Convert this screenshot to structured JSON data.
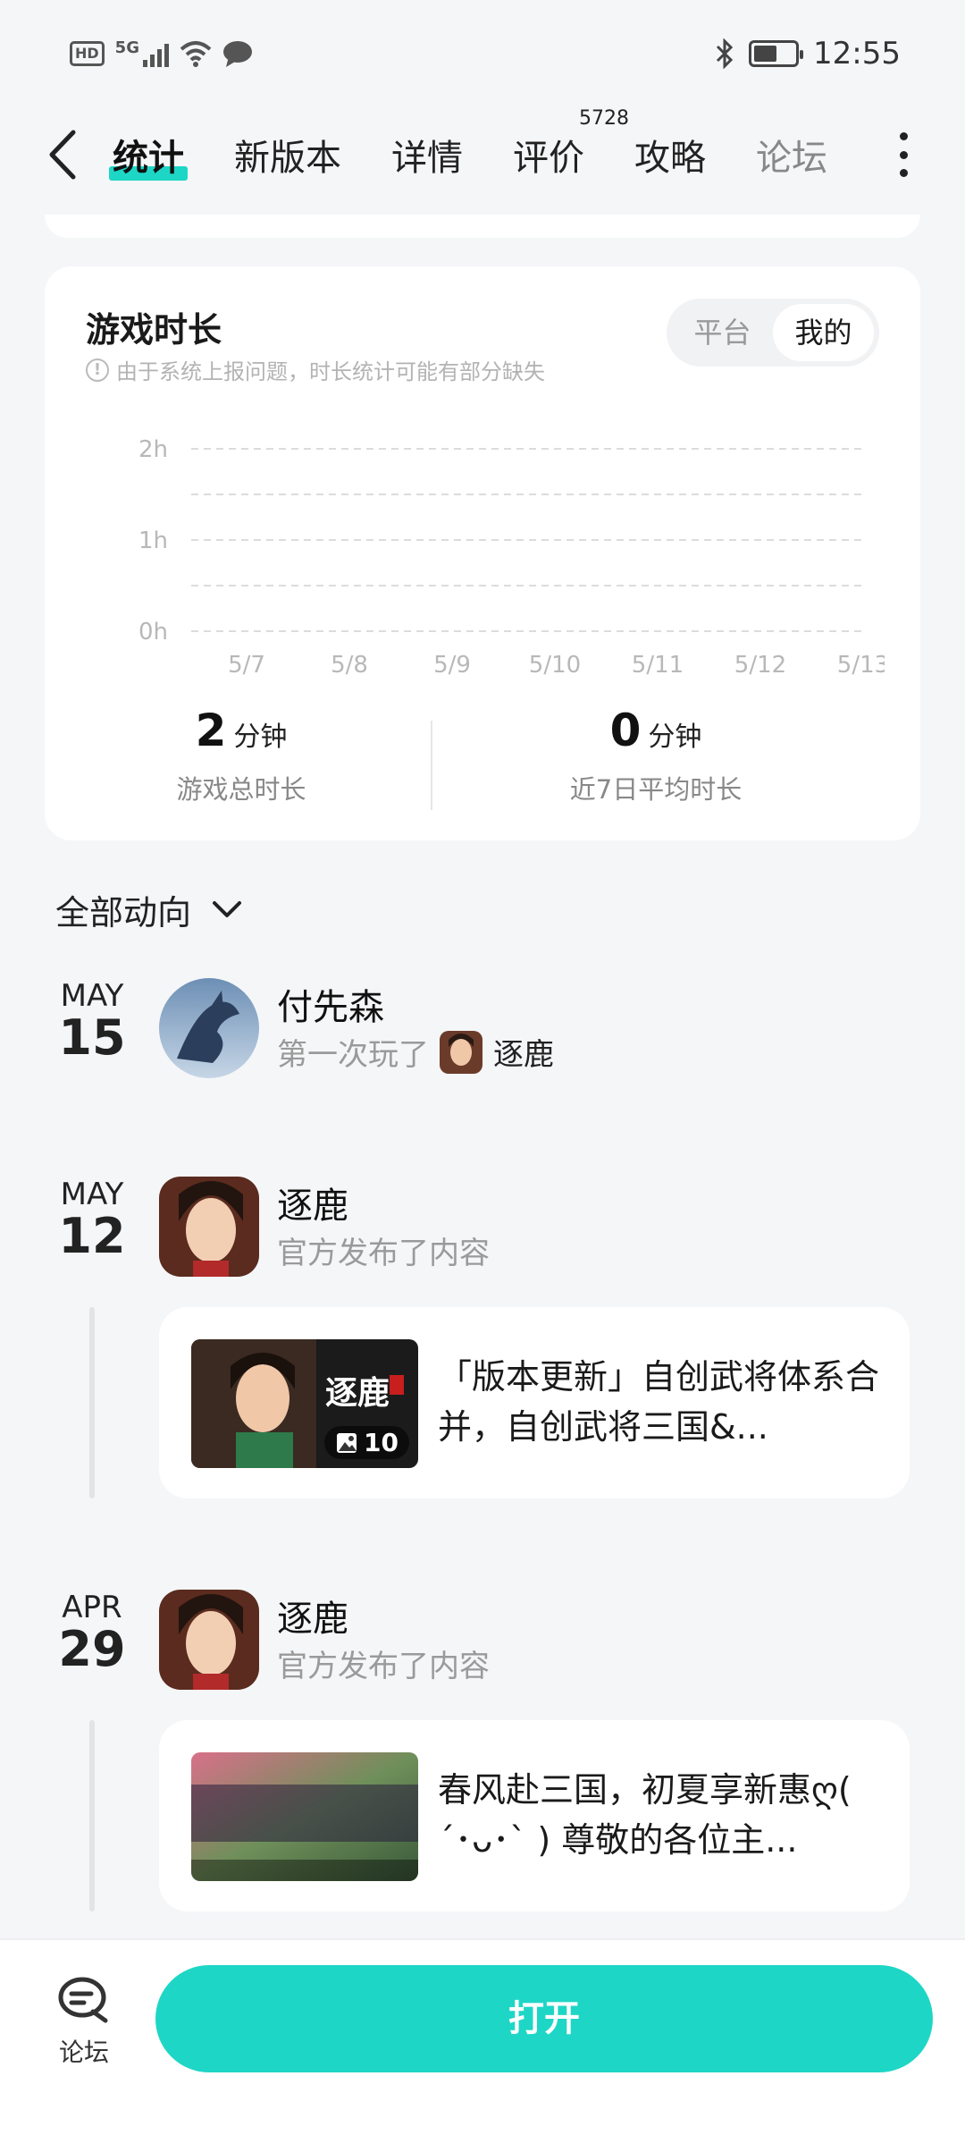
{
  "status_bar": {
    "hd": "HD",
    "network": "5G",
    "time": "12:55",
    "icons": [
      "hd-icon",
      "signal-icon",
      "wifi-icon",
      "message-icon",
      "bluetooth-icon",
      "battery-icon"
    ]
  },
  "nav": {
    "tabs": [
      {
        "label": "统计",
        "active": true
      },
      {
        "label": "新版本"
      },
      {
        "label": "详情"
      },
      {
        "label": "评价",
        "badge": "5728"
      },
      {
        "label": "攻略"
      },
      {
        "label": "论坛"
      }
    ]
  },
  "playtime": {
    "title": "游戏时长",
    "note": "由于系统上报问题，时长统计可能有部分缺失",
    "toggle": [
      "平台",
      "我的"
    ],
    "toggle_selected": "我的"
  },
  "chart_data": {
    "type": "line",
    "x": [
      "5/7",
      "5/8",
      "5/9",
      "5/10",
      "5/11",
      "5/12",
      "5/13"
    ],
    "y_ticks": [
      "2h",
      "1h",
      "0h"
    ],
    "ylim": [
      0,
      2
    ],
    "series": [
      {
        "values": [
          0,
          0,
          0,
          0,
          0,
          0,
          0
        ]
      }
    ],
    "grid": true
  },
  "summary": {
    "total_value": "2",
    "total_unit": "分钟",
    "total_label": "游戏总时长",
    "avg_value": "0",
    "avg_unit": "分钟",
    "avg_label": "近7日平均时长"
  },
  "feed": {
    "filter_label": "全部动向",
    "items": [
      {
        "month": "MAY",
        "day": "15",
        "name": "付先森",
        "action": "第一次玩了",
        "game": "逐鹿"
      },
      {
        "month": "MAY",
        "day": "12",
        "name": "逐鹿",
        "action": "官方发布了内容",
        "post_text": "「版本更新」自创武将体系合并，自创武将三国&...",
        "image_count": "10"
      },
      {
        "month": "APR",
        "day": "29",
        "name": "逐鹿",
        "action": "官方发布了内容",
        "post_text": "春风赴三国，初夏享新惠ღ( ´･ᴗ･` ) 尊敬的各位主..."
      }
    ]
  },
  "bottom_bar": {
    "forum_label": "论坛",
    "open_label": "打开",
    "accent": "#1ed6c6"
  }
}
